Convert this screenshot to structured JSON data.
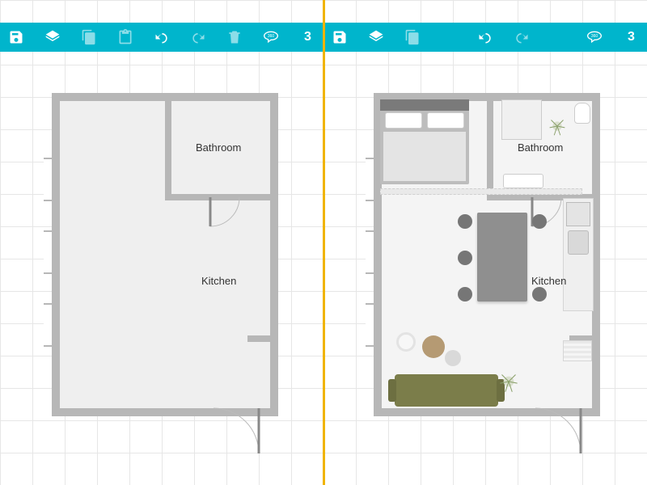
{
  "toolbar": {
    "save": "Save",
    "layers": "Layers",
    "copy": "Copy",
    "paste": "Paste",
    "undo": "Undo",
    "redo": "Redo",
    "delete": "Delete",
    "view360": "360",
    "view3d": "3"
  },
  "left_plan": {
    "bathroom_label": "Bathroom",
    "kitchen_label": "Kitchen"
  },
  "right_plan": {
    "bathroom_label": "Bathroom",
    "kitchen_label": "Kitchen"
  }
}
